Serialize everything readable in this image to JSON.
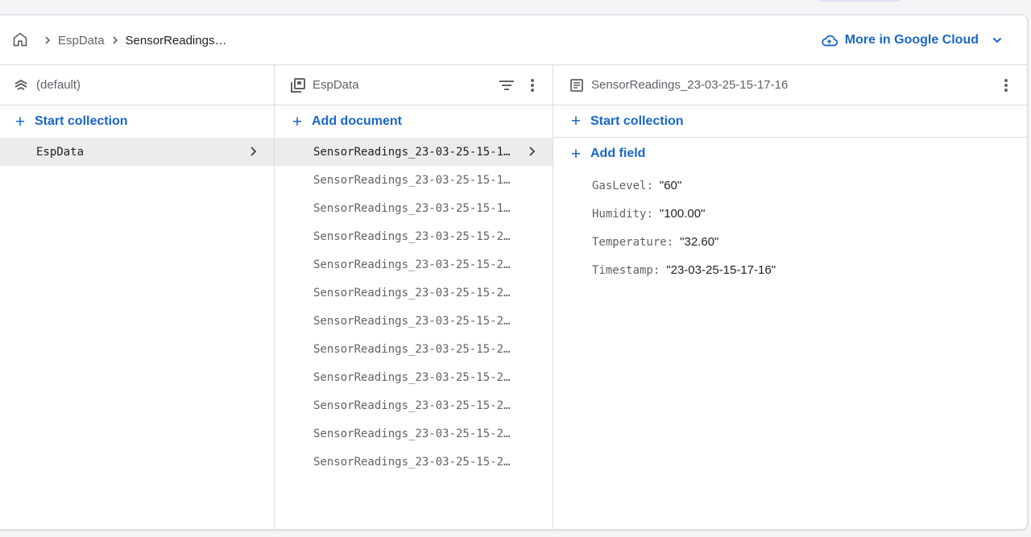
{
  "header": {
    "breadcrumbs": [
      "EspData",
      "SensorReadings…"
    ],
    "cloud_link_label": "More in Google Cloud"
  },
  "columns": {
    "database": {
      "title": "(default)",
      "action_label": "Start collection",
      "items": [
        {
          "label": "EspData",
          "selected": true
        }
      ]
    },
    "collection": {
      "title": "EspData",
      "action_label": "Add document",
      "documents": [
        "SensorReadings_23-03-25-15-1…",
        "SensorReadings_23-03-25-15-1…",
        "SensorReadings_23-03-25-15-1…",
        "SensorReadings_23-03-25-15-2…",
        "SensorReadings_23-03-25-15-2…",
        "SensorReadings_23-03-25-15-2…",
        "SensorReadings_23-03-25-15-2…",
        "SensorReadings_23-03-25-15-2…",
        "SensorReadings_23-03-25-15-2…",
        "SensorReadings_23-03-25-15-2…",
        "SensorReadings_23-03-25-15-2…",
        "SensorReadings_23-03-25-15-2…"
      ]
    },
    "document": {
      "title": "SensorReadings_23-03-25-15-17-16",
      "start_collection_label": "Start collection",
      "add_field_label": "Add field",
      "fields": [
        {
          "name": "GasLevel",
          "value": "\"60\""
        },
        {
          "name": "Humidity",
          "value": "\"100.00\""
        },
        {
          "name": "Temperature",
          "value": "\"32.60\""
        },
        {
          "name": "Timestamp",
          "value": "\"23-03-25-15-17-16\""
        }
      ]
    }
  },
  "colors": {
    "accent": "#1a66c9",
    "muted_text": "#5f6368",
    "selected_row": "#ececec",
    "divider": "#dadce0"
  },
  "icons": [
    "home-icon",
    "chevron-right-icon",
    "cloud-icon",
    "chevron-down-icon",
    "database-stack-icon",
    "collection-icon",
    "filter-icon",
    "more-vert-icon",
    "document-icon",
    "plus-icon"
  ]
}
